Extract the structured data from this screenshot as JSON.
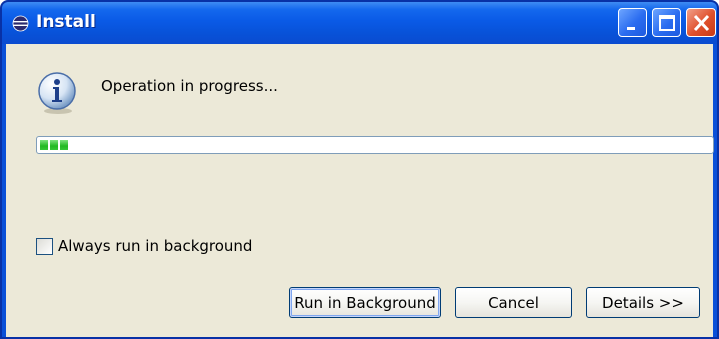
{
  "window": {
    "title": "Install",
    "title_icon": "eclipse-icon",
    "controls": {
      "minimize_icon": "minimize-icon",
      "maximize_icon": "maximize-icon",
      "close_icon": "close-icon"
    }
  },
  "dialog": {
    "icon": "info-icon",
    "message": "Operation in progress...",
    "progress_fraction": 0.04,
    "checkbox": {
      "label": "Always run in background",
      "checked": false
    },
    "buttons": {
      "run_background": "Run in Background",
      "cancel": "Cancel",
      "details": "Details >>"
    }
  },
  "colors": {
    "titlebar": "#0a5ae6",
    "client_bg": "#ece9d8",
    "progress_green": "#22b822",
    "close_button": "#e0502c"
  }
}
